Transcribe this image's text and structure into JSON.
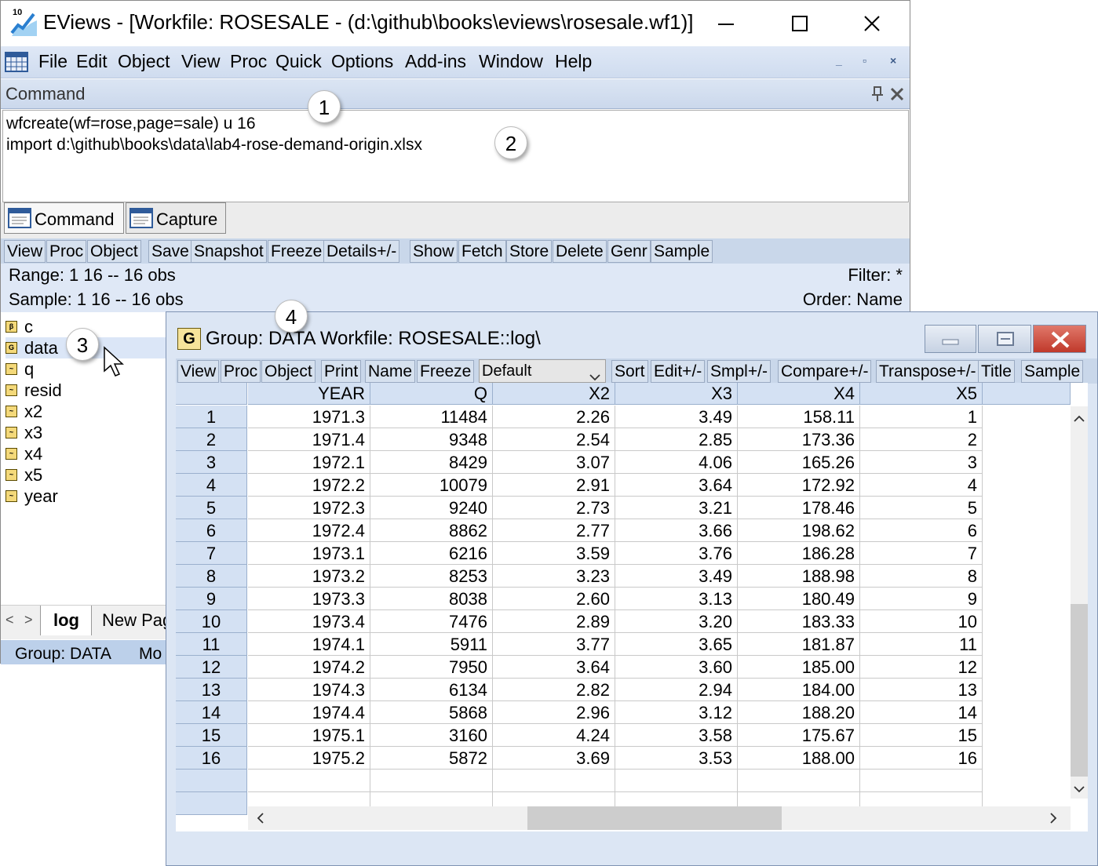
{
  "window": {
    "title": "EViews - [Workfile: ROSESALE - (d:\\github\\books\\eviews\\rosesale.wf1)]",
    "logo_text": "10"
  },
  "menu": [
    "File",
    "Edit",
    "Object",
    "View",
    "Proc",
    "Quick",
    "Options",
    "Add-ins",
    "Window",
    "Help"
  ],
  "command_pane": {
    "title": "Command",
    "lines": [
      "wfcreate(wf=rose,page=sale)  u 16",
      "import d:\\github\\books\\data\\lab4-rose-demand-origin.xlsx"
    ],
    "tabs": [
      "Command",
      "Capture"
    ]
  },
  "workfile_toolbar": [
    "View",
    "Proc",
    "Object",
    "Save",
    "Snapshot",
    "Freeze",
    "Details+/-",
    "Show",
    "Fetch",
    "Store",
    "Delete",
    "Genr",
    "Sample"
  ],
  "workfile_info": {
    "range": "Range:   1 16    --   16 obs",
    "sample": "Sample: 1 16    --   16 obs",
    "filter": "Filter: *",
    "order": "Order: Name"
  },
  "objects": [
    {
      "name": "c",
      "type": "β"
    },
    {
      "name": "data",
      "type": "G"
    },
    {
      "name": "q",
      "type": "~"
    },
    {
      "name": "resid",
      "type": "~"
    },
    {
      "name": "x2",
      "type": "~"
    },
    {
      "name": "x3",
      "type": "~"
    },
    {
      "name": "x4",
      "type": "~"
    },
    {
      "name": "x5",
      "type": "~"
    },
    {
      "name": "year",
      "type": "~"
    }
  ],
  "page_tabs": {
    "nav_left": "<",
    "nav_right": ">",
    "active": "log",
    "new": "New Pag"
  },
  "status_bar": {
    "left": "Group: DATA",
    "right": "Mo"
  },
  "callouts": [
    "1",
    "2",
    "3",
    "4"
  ],
  "group_window": {
    "icon_letter": "G",
    "title": "Group: DATA    Workfile: ROSESALE::log\\",
    "toolbar_left": [
      "View",
      "Proc",
      "Object",
      "Print",
      "Name",
      "Freeze"
    ],
    "format_select": "Default",
    "toolbar_right": [
      "Sort",
      "Edit+/-",
      "Smpl+/-",
      "Compare+/-",
      "Transpose+/-",
      "Title",
      "Sample"
    ],
    "columns": [
      "YEAR",
      "Q",
      "X2",
      "X3",
      "X4",
      "X5"
    ],
    "rows": [
      [
        "1",
        "1971.3",
        "11484",
        "2.26",
        "3.49",
        "158.11",
        "1"
      ],
      [
        "2",
        "1971.4",
        "9348",
        "2.54",
        "2.85",
        "173.36",
        "2"
      ],
      [
        "3",
        "1972.1",
        "8429",
        "3.07",
        "4.06",
        "165.26",
        "3"
      ],
      [
        "4",
        "1972.2",
        "10079",
        "2.91",
        "3.64",
        "172.92",
        "4"
      ],
      [
        "5",
        "1972.3",
        "9240",
        "2.73",
        "3.21",
        "178.46",
        "5"
      ],
      [
        "6",
        "1972.4",
        "8862",
        "2.77",
        "3.66",
        "198.62",
        "6"
      ],
      [
        "7",
        "1973.1",
        "6216",
        "3.59",
        "3.76",
        "186.28",
        "7"
      ],
      [
        "8",
        "1973.2",
        "8253",
        "3.23",
        "3.49",
        "188.98",
        "8"
      ],
      [
        "9",
        "1973.3",
        "8038",
        "2.60",
        "3.13",
        "180.49",
        "9"
      ],
      [
        "10",
        "1973.4",
        "7476",
        "2.89",
        "3.20",
        "183.33",
        "10"
      ],
      [
        "11",
        "1974.1",
        "5911",
        "3.77",
        "3.65",
        "181.87",
        "11"
      ],
      [
        "12",
        "1974.2",
        "7950",
        "3.64",
        "3.60",
        "185.00",
        "12"
      ],
      [
        "13",
        "1974.3",
        "6134",
        "2.82",
        "2.94",
        "184.00",
        "13"
      ],
      [
        "14",
        "1974.4",
        "5868",
        "2.96",
        "3.12",
        "188.20",
        "14"
      ],
      [
        "15",
        "1975.1",
        "3160",
        "4.24",
        "3.58",
        "175.67",
        "15"
      ],
      [
        "16",
        "1975.2",
        "5872",
        "3.69",
        "3.53",
        "188.00",
        "16"
      ]
    ]
  }
}
